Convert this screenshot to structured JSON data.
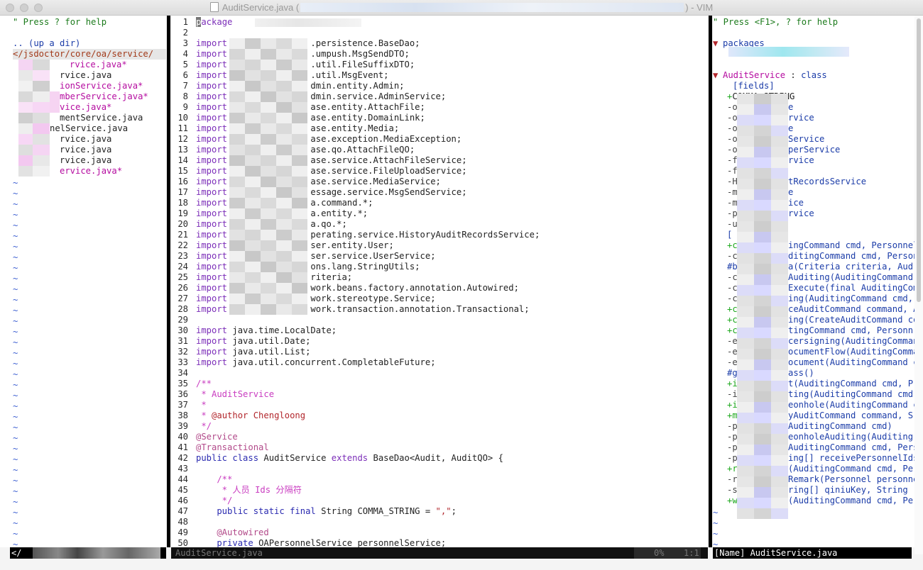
{
  "window": {
    "title_file": "AuditService.java",
    "title_suffix": "- VIM",
    "title_open_paren": "(",
    "title_close_paren": ")"
  },
  "colors": {
    "background": "#ffffff",
    "split_bar": "#000000",
    "tilde": "#3d5fd1",
    "comment_green": "#1c7b1c",
    "keyword_purple": "#7b2db8",
    "string_red": "#b2262c",
    "modified_magenta": "#b50ca0"
  },
  "left_pane": {
    "help": "\" Press ? for help",
    "up_dir": ".. (up a dir)",
    "dir": "</jsdoctor/core/oa/service/",
    "files": [
      {
        "text": "rvice.java*",
        "modified": true
      },
      {
        "text": "rvice.java",
        "modified": false
      },
      {
        "text": "ionService.java*",
        "modified": true
      },
      {
        "text": ":NumberService.java*",
        "modified": true
      },
      {
        "text": "vice.java*",
        "modified": true
      },
      {
        "text": "mentService.java",
        "modified": false
      },
      {
        "text": "nelService.java",
        "modified": false
      },
      {
        "text": "rvice.java",
        "modified": false
      },
      {
        "text": "rvice.java",
        "modified": false
      },
      {
        "text": "rvice.java",
        "modified": false
      },
      {
        "text": "ervice.java*",
        "modified": true
      }
    ],
    "tilde": "~",
    "status": "</"
  },
  "editor": {
    "lines": [
      {
        "n": "1",
        "parts": [
          [
            "kw",
            "package"
          ]
        ]
      },
      {
        "n": "2",
        "parts": []
      },
      {
        "n": "3",
        "parts": [
          [
            "kw",
            "import"
          ],
          [
            "id",
            "                .persistence.BaseDao;"
          ]
        ]
      },
      {
        "n": "4",
        "parts": [
          [
            "kw",
            "import"
          ],
          [
            "id",
            "                .umpush.MsgSendDTO;"
          ]
        ]
      },
      {
        "n": "5",
        "parts": [
          [
            "kw",
            "import"
          ],
          [
            "id",
            "                .util.FileSuffixDTO;"
          ]
        ]
      },
      {
        "n": "6",
        "parts": [
          [
            "kw",
            "import"
          ],
          [
            "id",
            "                .util.MsgEvent;"
          ]
        ]
      },
      {
        "n": "7",
        "parts": [
          [
            "kw",
            "import"
          ],
          [
            "id",
            "                dmin.entity.Admin;"
          ]
        ]
      },
      {
        "n": "8",
        "parts": [
          [
            "kw",
            "import"
          ],
          [
            "id",
            "                dmin.service.AdminService;"
          ]
        ]
      },
      {
        "n": "9",
        "parts": [
          [
            "kw",
            "import"
          ],
          [
            "id",
            "                ase.entity.AttachFile;"
          ]
        ]
      },
      {
        "n": "10",
        "parts": [
          [
            "kw",
            "import"
          ],
          [
            "id",
            "                ase.entity.DomainLink;"
          ]
        ]
      },
      {
        "n": "11",
        "parts": [
          [
            "kw",
            "import"
          ],
          [
            "id",
            "                ase.entity.Media;"
          ]
        ]
      },
      {
        "n": "12",
        "parts": [
          [
            "kw",
            "import"
          ],
          [
            "id",
            "                ase.exception.MediaException;"
          ]
        ]
      },
      {
        "n": "13",
        "parts": [
          [
            "kw",
            "import"
          ],
          [
            "id",
            "                ase.qo.AttachFileQO;"
          ]
        ]
      },
      {
        "n": "14",
        "parts": [
          [
            "kw",
            "import"
          ],
          [
            "id",
            "                ase.service.AttachFileService;"
          ]
        ]
      },
      {
        "n": "15",
        "parts": [
          [
            "kw",
            "import"
          ],
          [
            "id",
            "                ase.service.FileUploadService;"
          ]
        ]
      },
      {
        "n": "16",
        "parts": [
          [
            "kw",
            "import"
          ],
          [
            "id",
            "                ase.service.MediaService;"
          ]
        ]
      },
      {
        "n": "17",
        "parts": [
          [
            "kw",
            "import"
          ],
          [
            "id",
            "                essage.service.MsgSendService;"
          ]
        ]
      },
      {
        "n": "18",
        "parts": [
          [
            "kw",
            "import"
          ],
          [
            "id",
            "                a.command.*;"
          ]
        ]
      },
      {
        "n": "19",
        "parts": [
          [
            "kw",
            "import"
          ],
          [
            "id",
            "                a.entity.*;"
          ]
        ]
      },
      {
        "n": "20",
        "parts": [
          [
            "kw",
            "import"
          ],
          [
            "id",
            "                a.qo.*;"
          ]
        ]
      },
      {
        "n": "21",
        "parts": [
          [
            "kw",
            "import"
          ],
          [
            "id",
            "                perating.service.HistoryAuditRecordsService;"
          ]
        ]
      },
      {
        "n": "22",
        "parts": [
          [
            "kw",
            "import"
          ],
          [
            "id",
            "                ser.entity.User;"
          ]
        ]
      },
      {
        "n": "23",
        "parts": [
          [
            "kw",
            "import"
          ],
          [
            "id",
            "                ser.service.UserService;"
          ]
        ]
      },
      {
        "n": "24",
        "parts": [
          [
            "kw",
            "import"
          ],
          [
            "id",
            "                ons.lang.StringUtils;"
          ]
        ]
      },
      {
        "n": "25",
        "parts": [
          [
            "kw",
            "import"
          ],
          [
            "id",
            "                riteria;"
          ]
        ]
      },
      {
        "n": "26",
        "parts": [
          [
            "kw",
            "import"
          ],
          [
            "id",
            "                work.beans.factory.annotation.Autowired;"
          ]
        ]
      },
      {
        "n": "27",
        "parts": [
          [
            "kw",
            "import"
          ],
          [
            "id",
            "                work.stereotype.Service;"
          ]
        ]
      },
      {
        "n": "28",
        "parts": [
          [
            "kw",
            "import"
          ],
          [
            "id",
            "                work.transaction.annotation.Transactional;"
          ]
        ]
      },
      {
        "n": "29",
        "parts": []
      },
      {
        "n": "30",
        "parts": [
          [
            "kw",
            "import"
          ],
          [
            "id",
            " java.time.LocalDate;"
          ]
        ]
      },
      {
        "n": "31",
        "parts": [
          [
            "kw",
            "import"
          ],
          [
            "id",
            " java.util.Date;"
          ]
        ]
      },
      {
        "n": "32",
        "parts": [
          [
            "kw",
            "import"
          ],
          [
            "id",
            " java.util.List;"
          ]
        ]
      },
      {
        "n": "33",
        "parts": [
          [
            "kw",
            "import"
          ],
          [
            "id",
            " java.util.concurrent.CompletableFuture;"
          ]
        ]
      },
      {
        "n": "34",
        "parts": []
      },
      {
        "n": "35",
        "parts": [
          [
            "doc",
            "/**"
          ]
        ]
      },
      {
        "n": "36",
        "parts": [
          [
            "doc",
            " * AuditService"
          ]
        ]
      },
      {
        "n": "37",
        "parts": [
          [
            "doc",
            " *"
          ]
        ]
      },
      {
        "n": "38",
        "parts": [
          [
            "doc",
            " * "
          ],
          [
            "docat",
            "@author Chengloong"
          ]
        ]
      },
      {
        "n": "39",
        "parts": [
          [
            "doc",
            " */"
          ]
        ]
      },
      {
        "n": "40",
        "parts": [
          [
            "ann",
            "@Service"
          ]
        ]
      },
      {
        "n": "41",
        "parts": [
          [
            "ann",
            "@Transactional"
          ]
        ]
      },
      {
        "n": "42",
        "parts": [
          [
            "kwb",
            "public class "
          ],
          [
            "id",
            "AuditService "
          ],
          [
            "kw",
            "extends "
          ],
          [
            "id",
            "BaseDao<Audit, AuditQO> {"
          ]
        ]
      },
      {
        "n": "43",
        "parts": []
      },
      {
        "n": "44",
        "parts": [
          [
            "doc",
            "    /**"
          ]
        ]
      },
      {
        "n": "45",
        "parts": [
          [
            "doc",
            "     * 人员 Ids 分隔符"
          ]
        ]
      },
      {
        "n": "46",
        "parts": [
          [
            "doc",
            "     */"
          ]
        ]
      },
      {
        "n": "47",
        "parts": [
          [
            "kwb",
            "    public static final "
          ],
          [
            "id",
            "String COMMA_STRING = "
          ],
          [
            "str",
            "\",\""
          ],
          [
            "id",
            ";"
          ]
        ]
      },
      {
        "n": "48",
        "parts": []
      },
      {
        "n": "49",
        "parts": [
          [
            "ann",
            "    @Autowired"
          ]
        ]
      },
      {
        "n": "50",
        "parts": [
          [
            "kwb",
            "    private "
          ],
          [
            "id",
            "OAPersonnelService personnelService;"
          ]
        ]
      }
    ],
    "status_file": "AuditService.java",
    "status_percent": "0%",
    "status_pos": "1:1"
  },
  "tagbar": {
    "help": "\" Press <F1>, ? for help",
    "packages_label": "packages",
    "class_name": "AuditService",
    "class_sep": " : ",
    "class_kind": "class",
    "fields_label": "[fields]",
    "field_first": "COMMA_STRING",
    "items": [
      [
        "-o",
        "e"
      ],
      [
        "-o",
        "rvice"
      ],
      [
        "-o",
        "e"
      ],
      [
        "-o",
        "Service"
      ],
      [
        "-o",
        "perService"
      ],
      [
        "-f",
        "rvice"
      ],
      [
        "-f",
        ""
      ],
      [
        "-H",
        "tRecordsService"
      ],
      [
        "-m",
        "e"
      ],
      [
        "-m",
        "ice"
      ],
      [
        "-p",
        "rvice"
      ],
      [
        "-u",
        ""
      ],
      [
        "[",
        ""
      ],
      [
        "+c",
        "ingCommand cmd, Personnel"
      ],
      [
        "-c",
        "ditingCommand cmd, Person"
      ],
      [
        "#b",
        "a(Criteria criteria, Aud"
      ],
      [
        "-c",
        "Auditing(AuditingCommand"
      ],
      [
        "-c",
        "Execute(final AuditingCom"
      ],
      [
        "-c",
        "ing(AuditingCommand cmd,"
      ],
      [
        "+c",
        "ceAuditCommand command, A"
      ],
      [
        "+c",
        "ing(CreateAuditCommand co"
      ],
      [
        "+c",
        "tingCommand cmd, Personn"
      ],
      [
        "-e",
        "cersigning(AuditingComman"
      ],
      [
        "-e",
        "ocumentFlow(AuditingComma"
      ],
      [
        "-e",
        "ocument(AuditingCommand c"
      ],
      [
        "#g",
        "ass()"
      ],
      [
        "+i",
        "t(AuditingCommand cmd, P"
      ],
      [
        "-i",
        "ting(AuditingCommand cmd"
      ],
      [
        "+i",
        "eonhole(AuditingCommand c"
      ],
      [
        "+m",
        "yAuditCommand command, S"
      ],
      [
        "-p",
        "AuditingCommand cmd)"
      ],
      [
        "-p",
        "eonholeAuditing(Auditing"
      ],
      [
        "-p",
        "AuditingCommand cmd, Pers"
      ],
      [
        "-p",
        "ing[] receivePersonnelIds"
      ],
      [
        "+r",
        "(AuditingCommand cmd, Per"
      ],
      [
        "-r",
        "Remark(Personnel personne"
      ],
      [
        "-s",
        "ring[] qiniuKey, String"
      ],
      [
        "+w",
        "(AuditingCommand cmd, Per"
      ]
    ],
    "tilde": "~",
    "status": "[Name] AuditService.java"
  }
}
